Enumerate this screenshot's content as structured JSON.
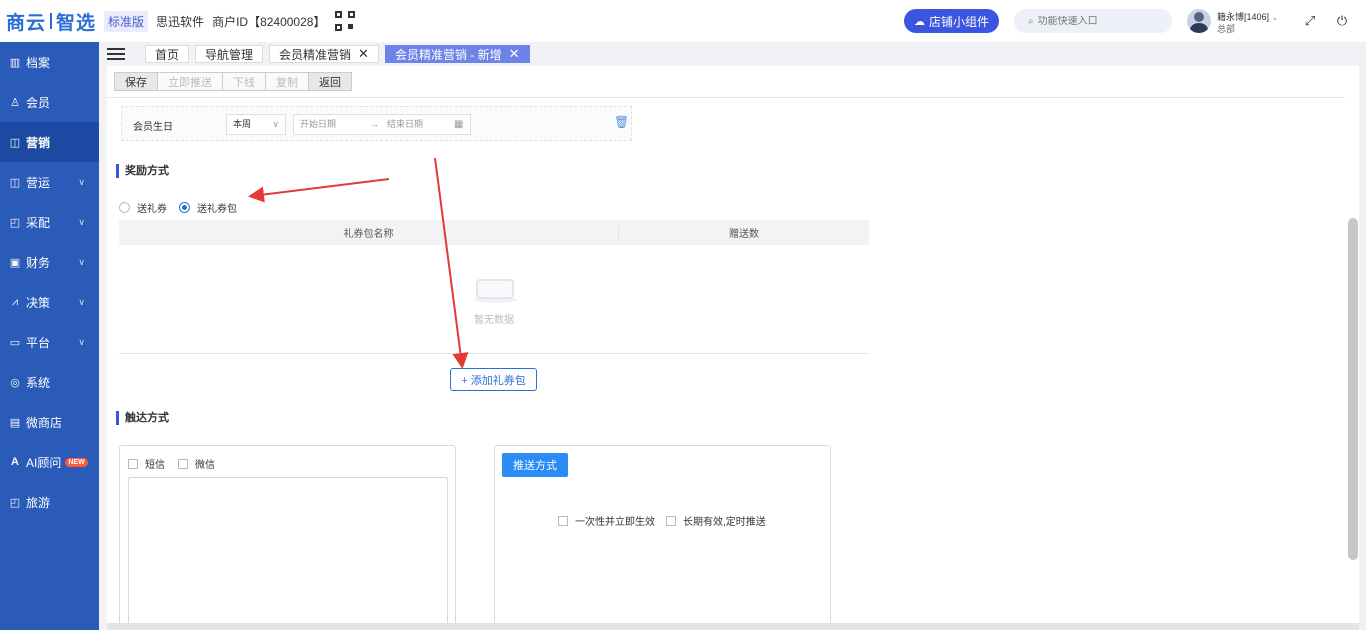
{
  "header": {
    "logo_part1": "商云",
    "logo_part2": "智选",
    "edition": "标准版",
    "company": "思迅软件",
    "merchant_id": "商户ID【82400028】",
    "shop_widget_label": "店铺小组件",
    "search_placeholder": "功能快速入口",
    "user_name": "籍永博[1406]",
    "user_org": "总部"
  },
  "sidebar": {
    "items": [
      {
        "label": "档案",
        "icon": "archive-icon"
      },
      {
        "label": "会员",
        "icon": "user-icon"
      },
      {
        "label": "营销",
        "icon": "marketing-icon"
      },
      {
        "label": "营运",
        "icon": "operation-icon"
      },
      {
        "label": "采配",
        "icon": "purchase-icon"
      },
      {
        "label": "财务",
        "icon": "finance-icon"
      },
      {
        "label": "决策",
        "icon": "decision-icon"
      },
      {
        "label": "平台",
        "icon": "platform-icon"
      },
      {
        "label": "系统",
        "icon": "system-icon"
      },
      {
        "label": "微商店",
        "icon": "shop-icon"
      },
      {
        "label": "AI顾问",
        "icon": "ai-icon",
        "badge": "NEW"
      },
      {
        "label": "旅游",
        "icon": "travel-icon"
      }
    ],
    "active_index": 2
  },
  "tabs": [
    {
      "label": "首页"
    },
    {
      "label": "导航管理"
    },
    {
      "label": "会员精准营销"
    },
    {
      "label": "会员精准营销 - 新增"
    }
  ],
  "toolbar": {
    "save": "保存",
    "push_now": "立即推送",
    "offline": "下线",
    "copy": "复制",
    "back": "返回"
  },
  "condition": {
    "label": "会员生日",
    "period_value": "本周",
    "start_placeholder": "开始日期",
    "arrow": "→",
    "end_placeholder": "结束日期"
  },
  "reward": {
    "title": "奖励方式",
    "option_coupon": "送礼券",
    "option_package": "送礼券包",
    "selected": "送礼券包",
    "col_name": "礼券包名称",
    "col_count": "赠送数",
    "empty_text": "暂无数据",
    "add_button": "+ 添加礼券包"
  },
  "delivery": {
    "title": "触达方式",
    "sms": "短信",
    "wechat": "微信",
    "push_method": "推送方式",
    "once_label": "一次性并立即生效",
    "longterm_label": "长期有效,定时推送"
  },
  "colors": {
    "sidebar_bg": "#2b5bb8",
    "accent": "#3b55e0",
    "primary_blue": "#2b6fd6",
    "annotation_red": "#e53935"
  }
}
